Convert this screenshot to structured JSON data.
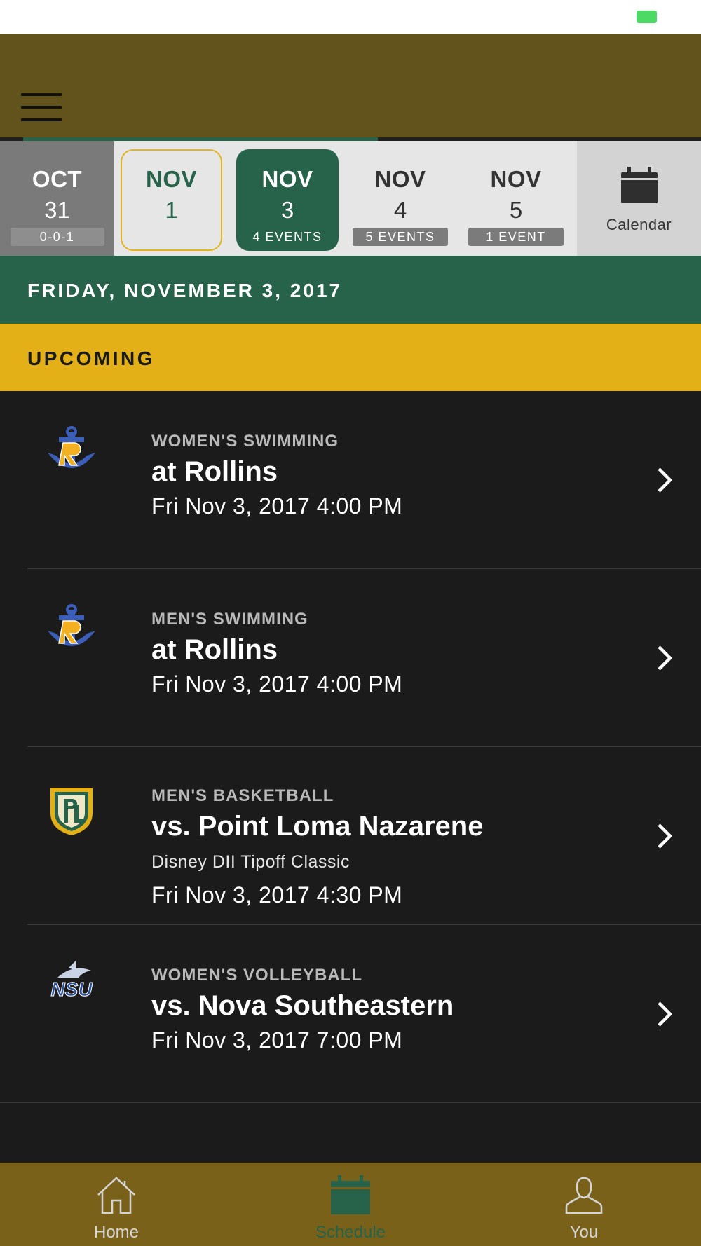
{
  "header": {
    "menu_icon": "hamburger-menu-icon"
  },
  "date_strip": {
    "prev": {
      "month": "OCT",
      "day": "31",
      "badge": "0-0-1"
    },
    "nov1": {
      "month": "NOV",
      "day": "1"
    },
    "nov3": {
      "month": "NOV",
      "day": "3",
      "badge": "4 EVENTS"
    },
    "nov4": {
      "month": "NOV",
      "day": "4",
      "badge": "5 EVENTS"
    },
    "nov5": {
      "month": "NOV",
      "day": "5",
      "badge": "1 EVENT"
    },
    "calendar": {
      "label": "Calendar",
      "icon": "calendar-icon"
    }
  },
  "day_banner": "FRIDAY, NOVEMBER 3, 2017",
  "section_banner": "UPCOMING",
  "events": [
    {
      "sport": "WOMEN'S SWIMMING",
      "opponent": "at Rollins",
      "datetime": "Fri Nov 3, 2017 4:00 PM",
      "logo": "rollins-anchor-logo"
    },
    {
      "sport": "MEN'S SWIMMING",
      "opponent": "at Rollins",
      "datetime": "Fri Nov 3, 2017 4:00 PM",
      "logo": "rollins-anchor-logo"
    },
    {
      "sport": "MEN'S BASKETBALL",
      "opponent": "vs. Point Loma Nazarene",
      "subtitle": "Disney DII Tipoff Classic",
      "datetime": "Fri Nov 3, 2017 4:30 PM",
      "logo": "point-loma-shield-logo"
    },
    {
      "sport": "WOMEN'S VOLLEYBALL",
      "opponent": "vs. Nova Southeastern",
      "datetime": "Fri Nov 3, 2017 7:00 PM",
      "logo": "nsu-shark-logo",
      "logo_text": "NSU"
    }
  ],
  "tabs": [
    {
      "label": "Home",
      "icon": "home-icon"
    },
    {
      "label": "Schedule",
      "icon": "calendar-icon",
      "active": true
    },
    {
      "label": "You",
      "icon": "person-icon"
    }
  ],
  "colors": {
    "header": "#62521c",
    "primary_green": "#26634a",
    "gold": "#e3b018",
    "tab_bar": "#7a611a",
    "list_bg": "#1b1b1b"
  }
}
